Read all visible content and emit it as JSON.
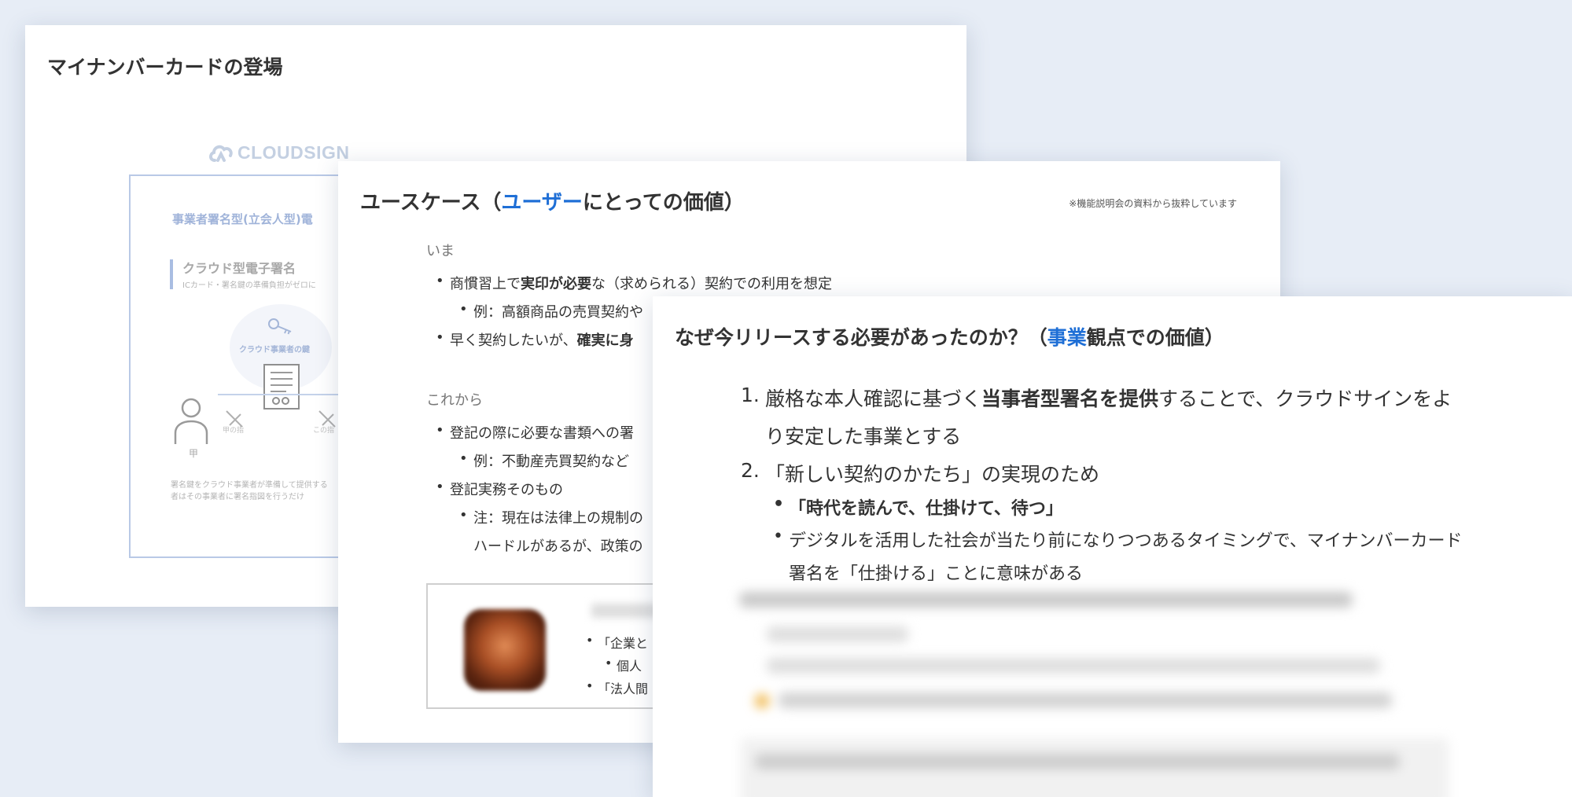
{
  "slide1": {
    "title": "マイナンバーカードの登場",
    "logo_text": "CLOUDSIGN",
    "diagram": {
      "heading": "事業者署名型(立会人型)電",
      "subheading": "クラウド型電子署名",
      "note": "ICカード・署名鍵の準備負担がゼロに",
      "cloud_label": "クラウド事業者の鍵",
      "person_label": "甲",
      "tag_left": "甲の指",
      "tag_right": "この指",
      "footer_line1": "署名鍵をクラウド事業者が準備して提供する",
      "footer_line2": "者はその事業者に署名指図を行うだけ",
      "colors": {
        "line": "#b9c9e6",
        "accent": "#9fb3d9"
      }
    }
  },
  "slide2": {
    "title_pre": "ユースケース（",
    "title_highlight": "ユーザー",
    "title_post": "にとっての価値）",
    "note": "※機能説明会の資料から抜粋しています",
    "now": {
      "label": "いま",
      "b1_pre": "商慣習上で",
      "b1_bold": "実印が必要",
      "b1_post": "な（求められる）契約での利用を想定",
      "b1_sub": "例：高額商品の売買契約や",
      "b2_pre": "早く契約したいが、",
      "b2_bold": "確実に身"
    },
    "future": {
      "label": "これから",
      "b1": "登記の際に必要な書類への署",
      "b1_sub": "例：不動産売買契約など",
      "b2": "登記実務そのもの",
      "b2_sub": "注：現在は法律上の規制の",
      "b2_sub_cont": "ハードルがあるが、政策の"
    },
    "quote": {
      "b1": "「企業と",
      "b1_sub": "個人",
      "b2": "「法人間"
    }
  },
  "slide3": {
    "title_pre": "なぜ今リリースする必要があったのか？（",
    "title_highlight": "事業",
    "title_post": "観点での価値）",
    "item1_num": "1.",
    "item1_pre": "厳格な本人確認に基づく",
    "item1_bold": "当事者型署名を提供",
    "item1_post": "することで、クラウドサインをよ",
    "item1_cont": "り安定した事業とする",
    "item2_num": "2.",
    "item2": "「新しい契約のかたち」の実現のため",
    "item2_b1": "「時代を読んで、仕掛けて、待つ」",
    "item2_b2": "デジタルを活用した社会が当たり前になりつつあるタイミングで、マイナンバーカード",
    "item2_b2_cont": "署名を「仕掛ける」ことに意味がある",
    "highlight_color": "#1f6fd6"
  }
}
